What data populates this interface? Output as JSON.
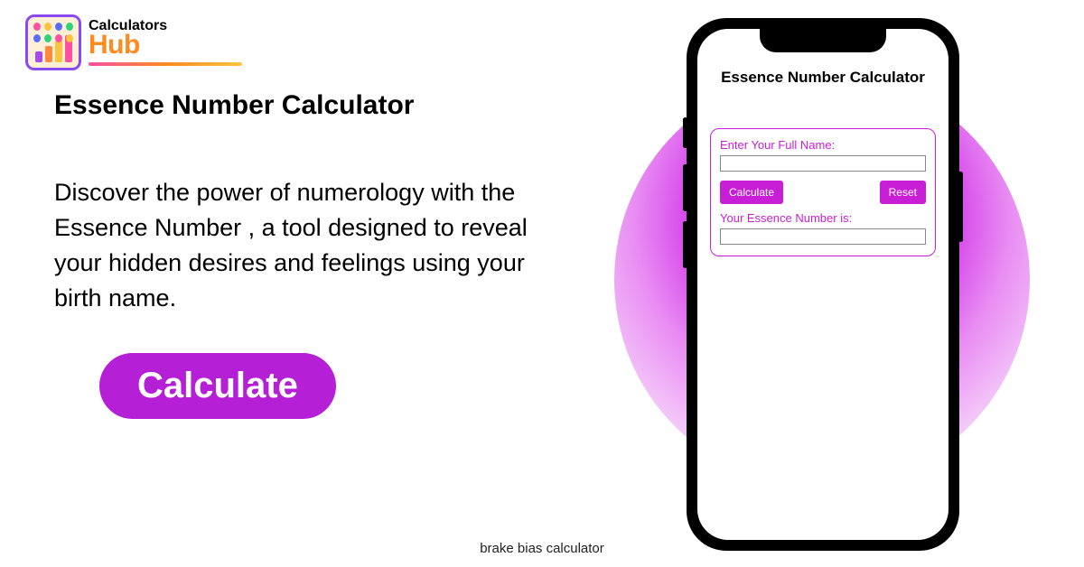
{
  "logo": {
    "line1": "Calculators",
    "line2": "Hub"
  },
  "title": "Essence Number Calculator",
  "description": "Discover the power of numerology with the Essence Number , a tool designed to reveal your hidden desires and feelings using your birth name.",
  "cta_label": "Calculate",
  "caption": "brake bias calculator",
  "phone": {
    "app_title": "Essence Number Calculator",
    "name_label": "Enter Your Full Name:",
    "name_value": "",
    "calc_label": "Calculate",
    "reset_label": "Reset",
    "result_label": "Your Essence Number is:",
    "result_value": ""
  }
}
